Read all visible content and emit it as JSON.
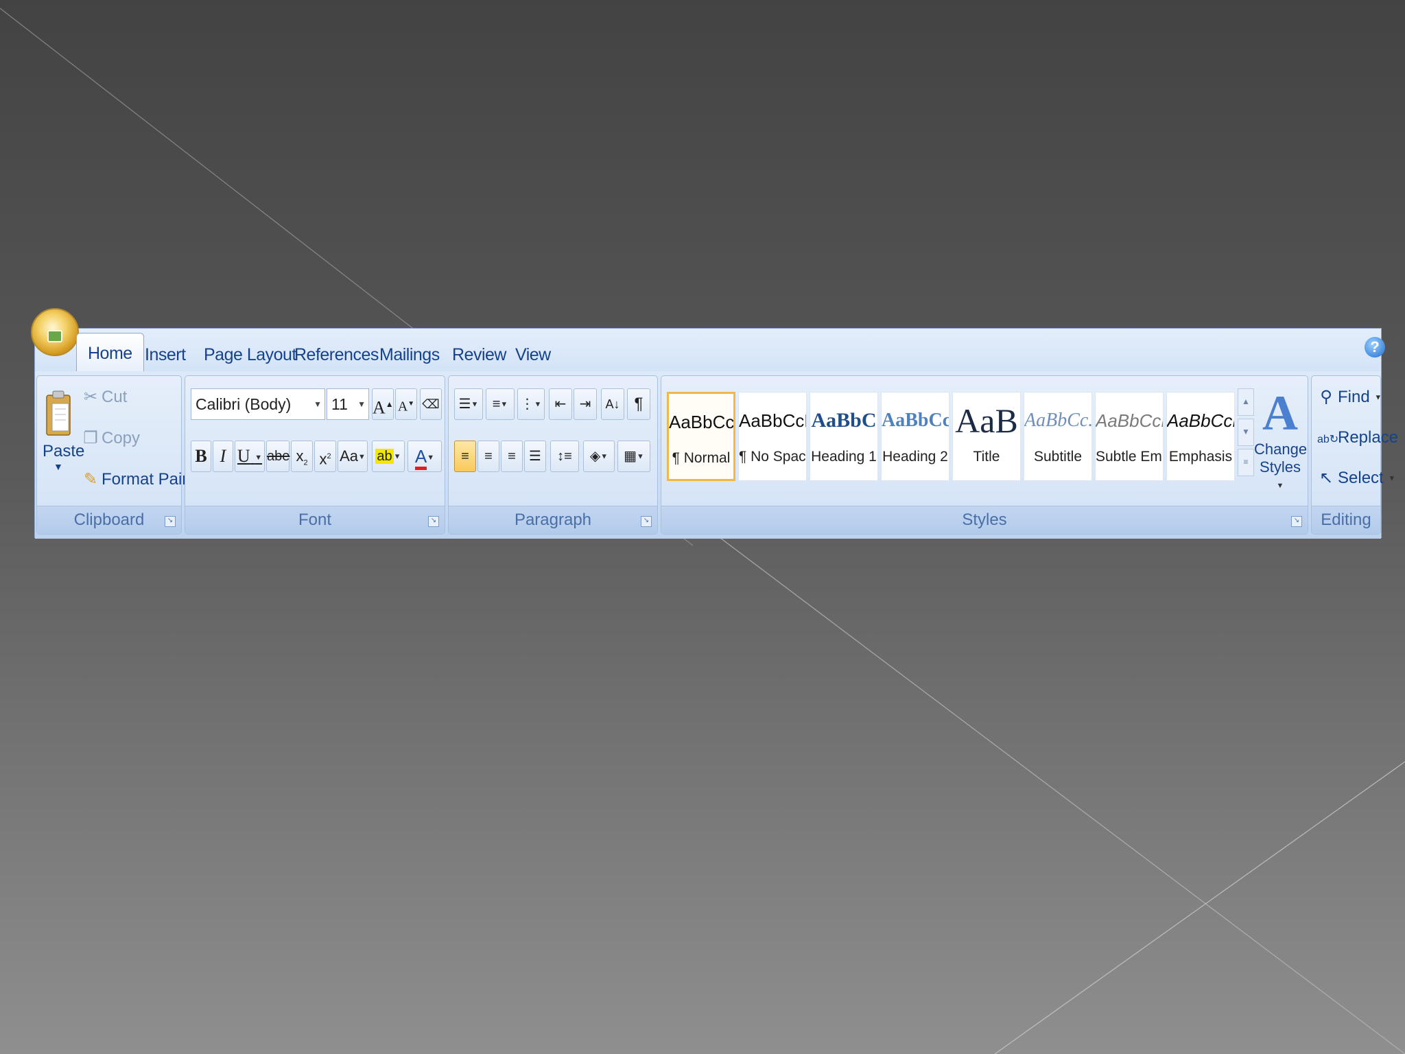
{
  "tabs": [
    {
      "label": "Home"
    },
    {
      "label": "Insert"
    },
    {
      "label": "Page Layout"
    },
    {
      "label": "References"
    },
    {
      "label": "Mailings"
    },
    {
      "label": "Review"
    },
    {
      "label": "View"
    }
  ],
  "active_tab": "Home",
  "clipboard": {
    "group_label": "Clipboard",
    "paste": "Paste",
    "cut": "Cut",
    "copy": "Copy",
    "format_painter": "Format Painter"
  },
  "font": {
    "group_label": "Font",
    "font_name": "Calibri (Body)",
    "font_size": "11",
    "bold": "B",
    "italic": "I",
    "underline": "U",
    "strikethrough": "abe",
    "subscript": "x",
    "superscript": "x",
    "change_case": "Aa",
    "highlight": "ab",
    "font_color": "A"
  },
  "paragraph": {
    "group_label": "Paragraph",
    "show_marks": "¶",
    "align_left_active": true
  },
  "styles": {
    "group_label": "Styles",
    "items": [
      {
        "sample": "AaBbCcDc",
        "name": "¶ Normal"
      },
      {
        "sample": "AaBbCcDc",
        "name": "¶ No Spaci..."
      },
      {
        "sample": "AaBbC",
        "name": "Heading 1"
      },
      {
        "sample": "AaBbCc",
        "name": "Heading 2"
      },
      {
        "sample": "AaB",
        "name": "Title"
      },
      {
        "sample": "AaBbCc.",
        "name": "Subtitle"
      },
      {
        "sample": "AaBbCcDc",
        "name": "Subtle Em..."
      },
      {
        "sample": "AaBbCcDc",
        "name": "Emphasis"
      }
    ],
    "change_styles_line1": "Change",
    "change_styles_line2": "Styles"
  },
  "editing": {
    "group_label": "Editing",
    "find": "Find",
    "replace": "Replace",
    "select": "Select"
  },
  "help_glyph": "?",
  "colors": {
    "tab_text": "#15428b",
    "group_label": "#4a6fa5",
    "highlight_yellow": "#f4e700",
    "font_color_red": "#e02020",
    "normal_border": "#f0b848",
    "heading1_color": "#1f4e8a",
    "heading2_color": "#4f81bd",
    "title_color": "#1b2a45",
    "subtitle_color": "#6f8fbf",
    "subtle_em_color": "#7a7a7a"
  }
}
